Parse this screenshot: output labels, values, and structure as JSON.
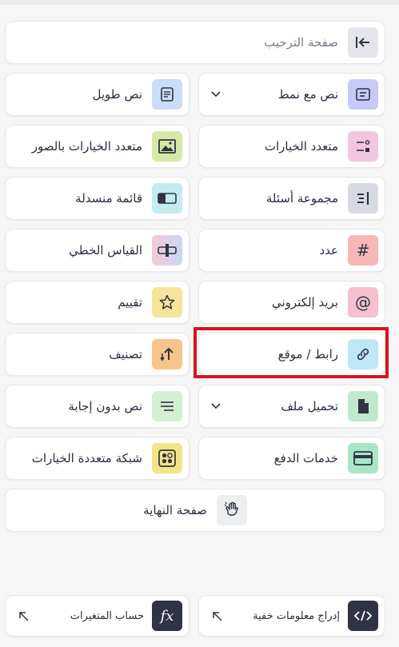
{
  "welcome": {
    "label": "صفحة الترحيب",
    "icon": "collapse-left-icon"
  },
  "items": [
    {
      "key": "styled-text",
      "label": "نص مع نمط",
      "icon": "styled-text-icon",
      "color": "#c7c9f7",
      "dropdown": true
    },
    {
      "key": "long-text",
      "label": "نص طويل",
      "icon": "document-icon",
      "color": "#c9dcf8"
    },
    {
      "key": "multiple-choice",
      "label": "متعدد الخيارات",
      "icon": "choices-icon",
      "color": "#f3c6df"
    },
    {
      "key": "picture-choice",
      "label": "متعدد الخيارات بالصور",
      "icon": "image-icon",
      "color": "#d7e7a8"
    },
    {
      "key": "question-group",
      "label": "مجموعة أسئلة",
      "icon": "group-icon",
      "color": "#d7d9e3"
    },
    {
      "key": "dropdown",
      "label": "قائمة منسدلة",
      "icon": "dropdown-icon",
      "color": "#c4ecec"
    },
    {
      "key": "number",
      "label": "عدد",
      "icon": "hash-icon",
      "color": "#f7b7b7"
    },
    {
      "key": "linear-scale",
      "label": "القياس الخطي",
      "icon": "slider-icon",
      "color": "#e6d2f2"
    },
    {
      "key": "email",
      "label": "بريد إلكتروني",
      "icon": "at-icon",
      "color": "#f6c0cf"
    },
    {
      "key": "rating",
      "label": "تقييم",
      "icon": "star-icon",
      "color": "#f7e39a"
    },
    {
      "key": "website",
      "label": "رابط / موقع",
      "icon": "link-icon",
      "color": "#bfe6f7"
    },
    {
      "key": "ranking",
      "label": "تصنيف",
      "icon": "sort-icon",
      "color": "#f7c58b"
    },
    {
      "key": "file-upload",
      "label": "تحميل ملف",
      "icon": "file-icon",
      "color": "#bfe9cf",
      "dropdown": true
    },
    {
      "key": "statement",
      "label": "نص بدون إجابة",
      "icon": "lines-icon",
      "color": "#d3f0d3"
    },
    {
      "key": "payment",
      "label": "خدمات الدفع",
      "icon": "card-icon",
      "color": "#a9e6c8"
    },
    {
      "key": "matrix",
      "label": "شبكة متعددة الخيارات",
      "icon": "grid-icon",
      "color": "#f1e487"
    }
  ],
  "ending": {
    "label": "صفحة النهاية",
    "icon": "wave-icon"
  },
  "bottom": {
    "hidden_fields": {
      "label": "إدراج معلومات خفية",
      "icon": "code-icon"
    },
    "variables": {
      "label": "حساب المتغيرات",
      "icon": "function-icon",
      "glyph": "fx"
    }
  }
}
